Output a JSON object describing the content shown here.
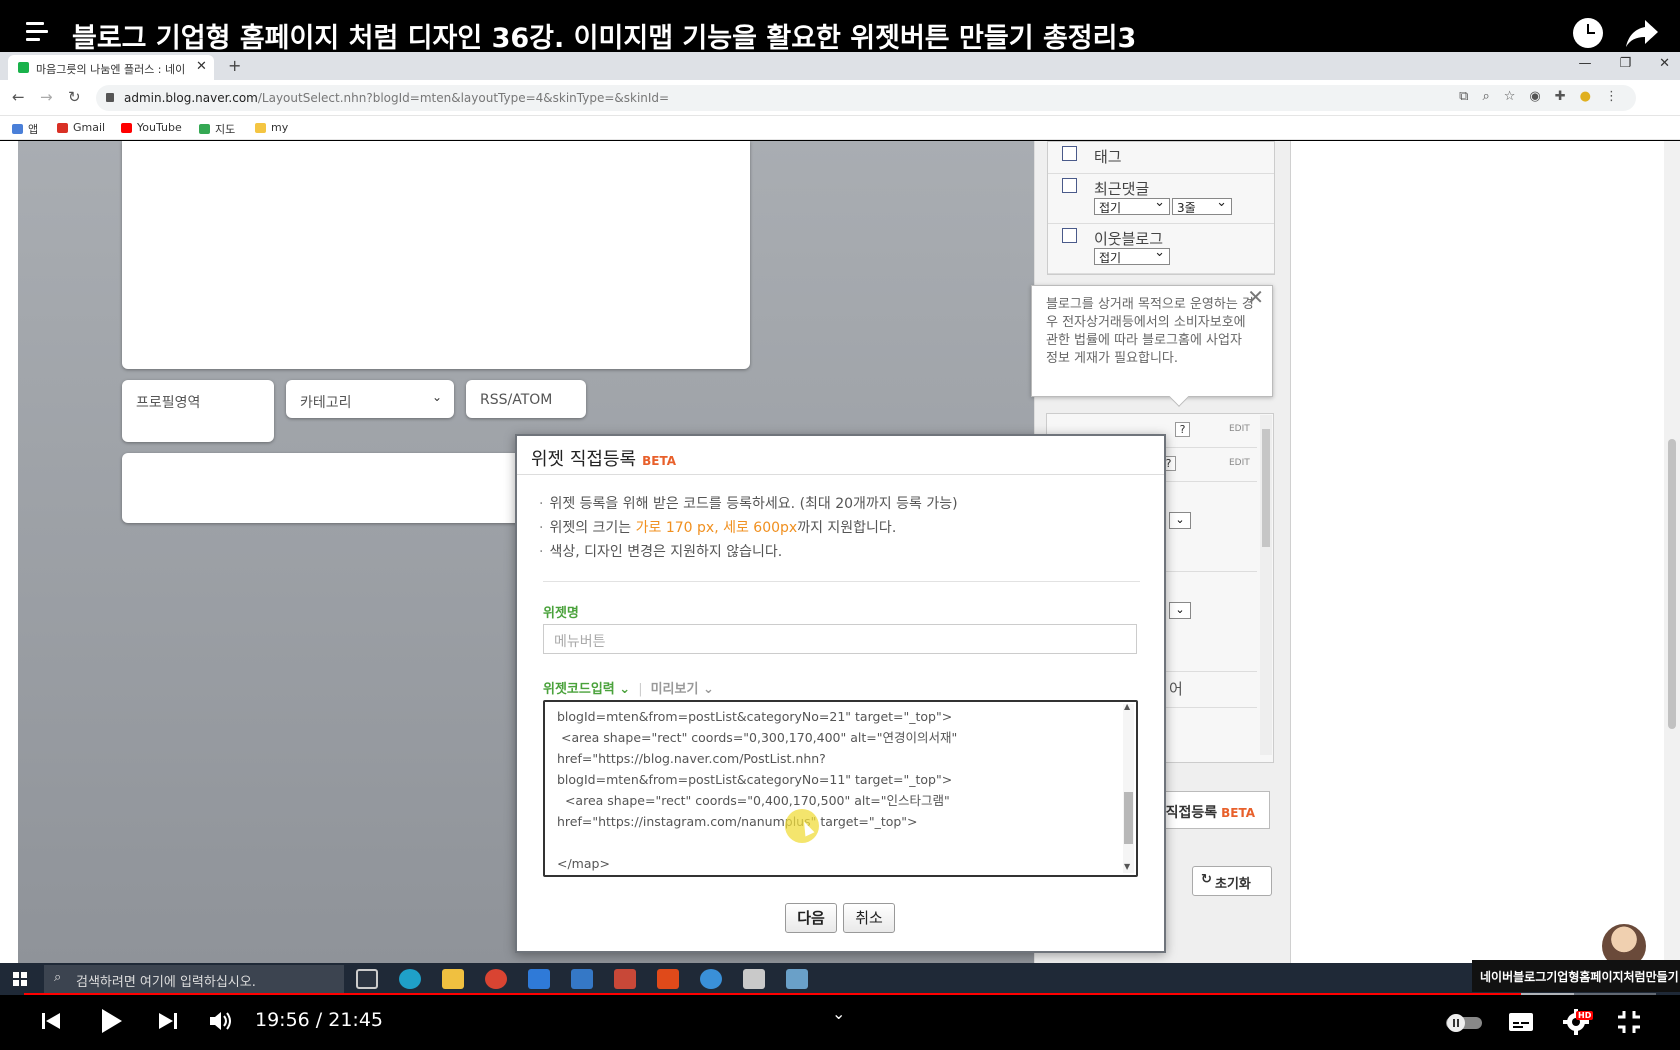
{
  "video": {
    "title": "블로그 기업형 홈페이지 처럼 디자인 36강. 이미지맵 기능을 활요한 위젯버튼 만들기 총정리3",
    "current_time": "19:56",
    "duration": "21:45",
    "time_display": "19:56 / 21:45",
    "progress_fraction": 0.917,
    "buffer_fraction": 0.95,
    "hd_badge": "HD",
    "channel_tag": "네이버블로그기업형홈페이지처럼만들기"
  },
  "browser": {
    "tab_title": "마음그릇의 나눔엔 플러스 : 네이",
    "url_host": "admin.blog.naver.com",
    "url_path": "/LayoutSelect.nhn?blogId=mten&layoutType=4&skinType=&skinId=",
    "bookmarks": [
      "앱",
      "Gmail",
      "YouTube",
      "지도",
      "my"
    ]
  },
  "preview": {
    "profile_label": "프로필영역",
    "category_label": "카테고리",
    "rss_label": "RSS/ATOM"
  },
  "right_panel": {
    "items": [
      {
        "label": "태그"
      },
      {
        "label": "최근댓글",
        "select1": "접기",
        "select2": "3줄"
      },
      {
        "label": "이웃블로그",
        "select1": "접기"
      }
    ],
    "edit_label": "EDIT",
    "help_label": "?",
    "partial_text": "어",
    "widget_register_label": "위젯 직접등록",
    "widget_register_beta": "BETA",
    "reset_label": "초기화"
  },
  "tooltip": {
    "text": "블로그를 상거래 목적으로 운영하는 경우 전자상거래등에서의 소비자보호에 관한 법률에 따라 블로그홈에 사업자 정보 게재가 필요합니다.",
    "close_label": "✕"
  },
  "dialog": {
    "title": "위젯 직접등록",
    "beta": "BETA",
    "note1": "위젯 등록을 위해 받은 코드를 등록하세요. (최대 20개까지 등록 가능)",
    "note2_pre": "위젯의 크기는 ",
    "note2_hl": "가로 170 px, 세로 600px",
    "note2_post": "까지 지원합니다.",
    "note3": "색상, 디자인 변경은 지원하지 않습니다.",
    "name_label": "위젯명",
    "name_value": "메뉴버튼",
    "tab_code": "위젯코드입력 ⌄",
    "tab_preview": "미리보기 ⌄",
    "code": "blogId=mten&from=postList&categoryNo=21\" target=\"_top\">\n <area shape=\"rect\" coords=\"0,300,170,400\" alt=\"연경이의서재\"\nhref=\"https://blog.naver.com/PostList.nhn?\nblogId=mten&from=postList&categoryNo=11\" target=\"_top\">\n  <area shape=\"rect\" coords=\"0,400,170,500\" alt=\"인스타그램\"\nhref=\"https://instagram.com/nanumplus\" target=\"_top\">\n\n</map>",
    "next_label": "다음",
    "cancel_label": "취소"
  },
  "taskbar": {
    "search_placeholder": "검색하려면 여기에 입력하십시오."
  }
}
